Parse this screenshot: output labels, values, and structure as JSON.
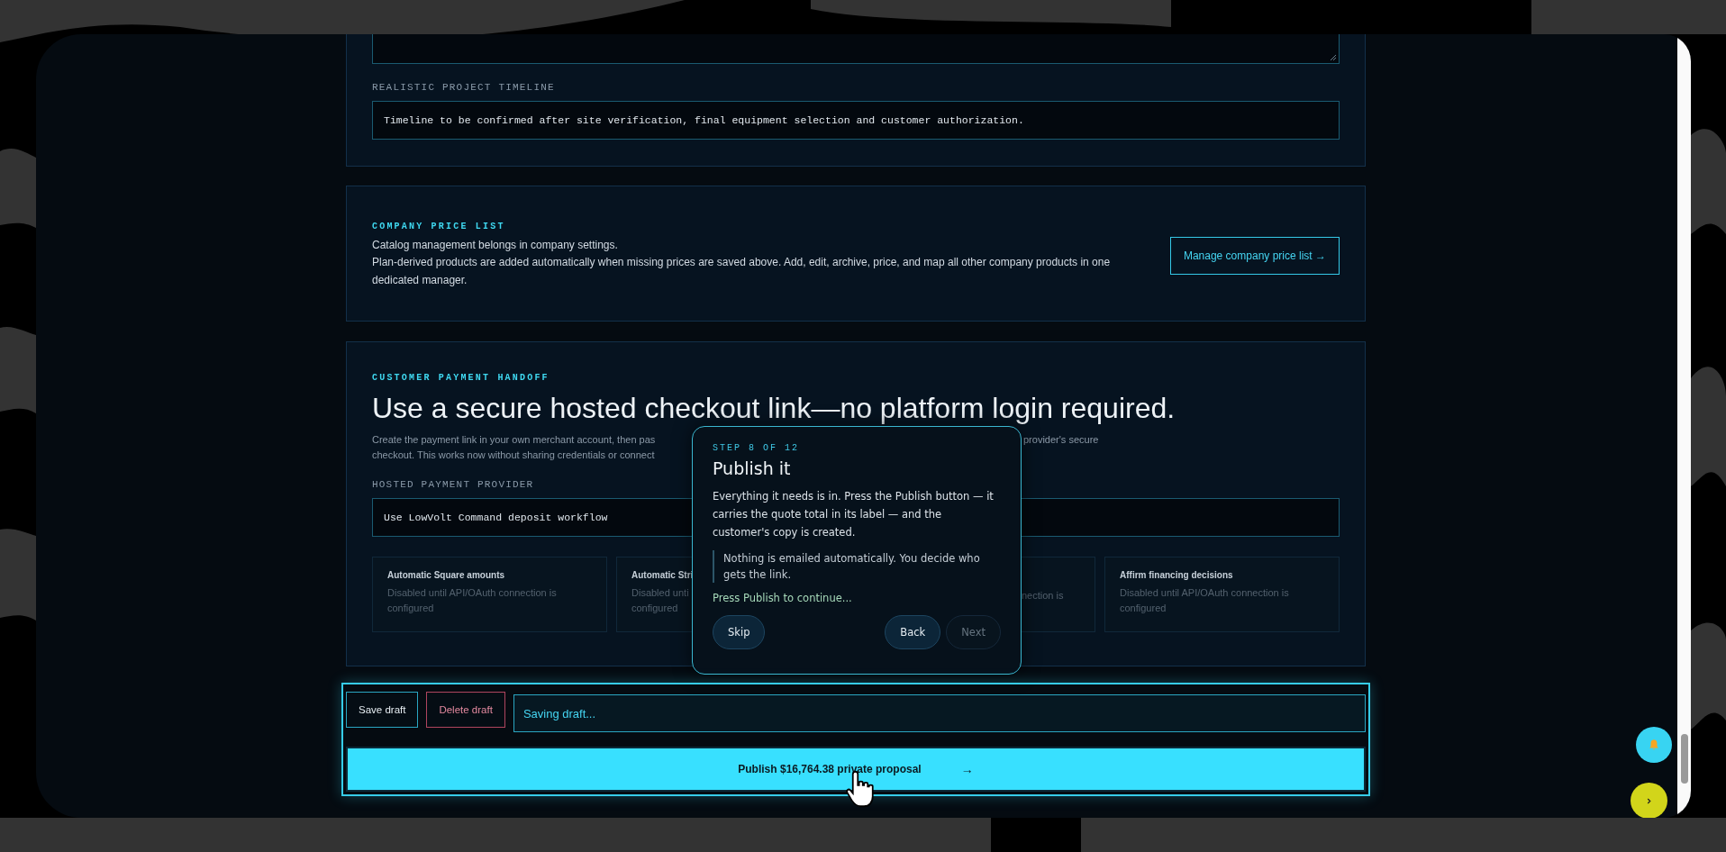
{
  "timeline_card": {
    "label": "REALISTIC PROJECT TIMELINE",
    "value": "Timeline to be confirmed after site verification, final equipment selection and customer authorization."
  },
  "price_list_card": {
    "eyebrow": "COMPANY PRICE LIST",
    "lines": [
      "Catalog management belongs in company settings.",
      "Plan-derived products are added automatically when missing prices are saved above. Add, edit, archive, price, and map all other company products in one dedicated manager."
    ],
    "button": "Manage company price list →"
  },
  "payment_card": {
    "eyebrow": "CUSTOMER PAYMENT HANDOFF",
    "heading": "Use a secure hosted checkout link—no platform login required.",
    "intro_parts": [
      "Create the payment link in your own merchant account, then pas",
      "provider's secure",
      "checkout. This works now without sharing credentials or connect"
    ],
    "provider_label": "HOSTED PAYMENT PROVIDER",
    "provider_value": "Use LowVolt Command deposit workflow",
    "integrations": [
      {
        "kind": "full",
        "title": "Automatic Square amounts",
        "lines": [
          "Disabled until API/OAuth connection is",
          "configured"
        ]
      },
      {
        "kind": "full",
        "title": "Automatic Stri",
        "lines": [
          "Disabled unti",
          "configured"
        ]
      },
      {
        "kind": "covered",
        "lines": [
          "nection is"
        ]
      },
      {
        "kind": "full",
        "title": "Affirm financing decisions",
        "lines": [
          "Disabled until API/OAuth connection is",
          "configured"
        ]
      }
    ]
  },
  "tour": {
    "step": "STEP 8 OF 12",
    "title": "Publish it",
    "body": "Everything it needs is in. Press the Publish button — it carries the quote total in its label — and the customer's copy is created.",
    "note": "Nothing is emailed automatically. You decide who gets the link.",
    "prompt": "Press Publish to continue...",
    "buttons": [
      {
        "label": "Skip",
        "disabled": false
      },
      {
        "label": "Back",
        "disabled": false
      },
      {
        "label": "Next",
        "disabled": true
      }
    ]
  },
  "actions": {
    "save": "Save draft",
    "delete": "Delete draft",
    "status": "Saving draft...",
    "publish": "Publish $16,764.38 private proposal",
    "publish_arrow": "→"
  }
}
